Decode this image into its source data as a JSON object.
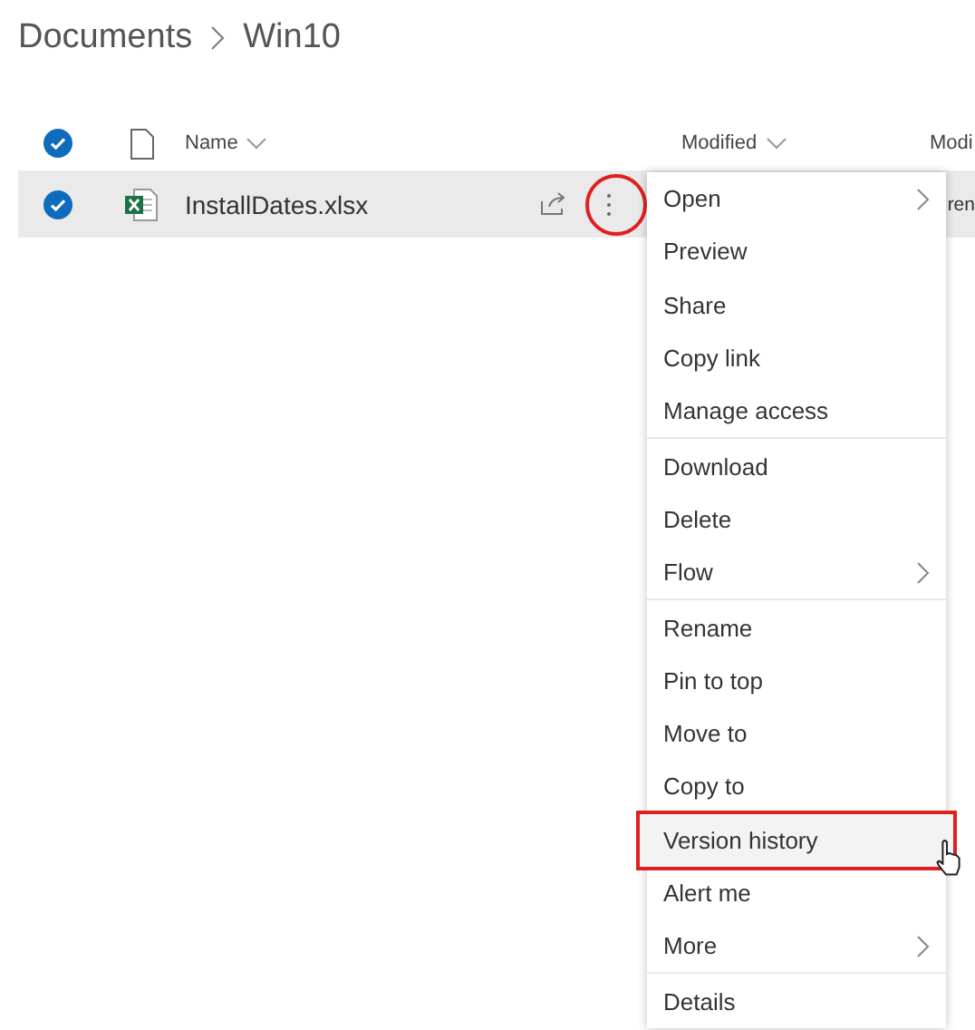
{
  "breadcrumb": [
    "Documents",
    "Win10"
  ],
  "columns": [
    {
      "label": "Name",
      "sortable": true
    },
    {
      "label": "Modified",
      "sortable": true
    },
    {
      "label": "Modi",
      "sortable": false
    }
  ],
  "header_checked": true,
  "rows": [
    {
      "name": "InstallDates.xlsx",
      "selected": true,
      "column_3": "ren",
      "annotated_more": true
    }
  ],
  "menu": {
    "groups": [
      [
        {
          "label": "Open",
          "submenu": true,
          "highlighted": false
        },
        {
          "label": "Preview",
          "submenu": false,
          "highlighted": false
        },
        {
          "label": "Share",
          "submenu": false,
          "highlighted": false
        },
        {
          "label": "Copy link",
          "submenu": false,
          "highlighted": false
        },
        {
          "label": "Manage access",
          "submenu": false,
          "highlighted": false
        }
      ],
      [
        {
          "label": "Download",
          "submenu": false,
          "highlighted": false
        },
        {
          "label": "Delete",
          "submenu": false,
          "highlighted": false
        },
        {
          "label": "Flow",
          "submenu": true,
          "highlighted": false
        }
      ],
      [
        {
          "label": "Rename",
          "submenu": false,
          "highlighted": false
        },
        {
          "label": "Pin to top",
          "submenu": false,
          "highlighted": false
        },
        {
          "label": "Move to",
          "submenu": false,
          "highlighted": false
        },
        {
          "label": "Copy to",
          "submenu": false,
          "highlighted": false
        },
        {
          "label": "Version history",
          "submenu": false,
          "highlighted": true
        },
        {
          "label": "Alert me",
          "submenu": false,
          "highlighted": false
        },
        {
          "label": "More",
          "submenu": true,
          "highlighted": false
        }
      ],
      [
        {
          "label": "Details",
          "submenu": false,
          "highlighted": false
        }
      ]
    ]
  }
}
